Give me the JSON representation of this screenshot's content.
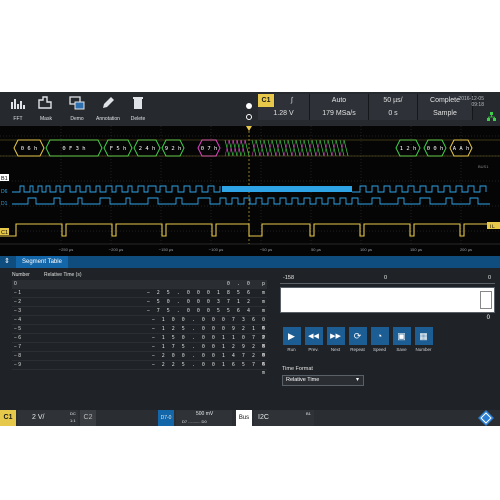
{
  "toolbar": {
    "items": [
      {
        "label": "FFT",
        "icon": "fft-icon"
      },
      {
        "label": "Mask",
        "icon": "mask-icon"
      },
      {
        "label": "Demo",
        "icon": "demo-icon"
      },
      {
        "label": "Annotation",
        "icon": "annotation-icon"
      },
      {
        "label": "Delete",
        "icon": "delete-icon"
      }
    ]
  },
  "trigger": {
    "channel": "C1",
    "level": "1.28 V",
    "mode": "Auto",
    "sample_rate": "179 MSa/s",
    "timebase": "50 µs/",
    "position": "0 s",
    "state": "Complete",
    "acquire": "Sample"
  },
  "datetime": {
    "date": "2016-12-05",
    "time": "09:18"
  },
  "waveform": {
    "bus_label": "B1",
    "bus_hint": "BUS1",
    "ch_d6": "D6",
    "ch_d1": "D1",
    "ch_c1": "C1",
    "tl": "TL",
    "decoded_left": [
      "0 6 h",
      "0 F 3 h",
      "F 5 h",
      "2 4 h",
      "9 2 h",
      "0 7 h"
    ],
    "decoded_right": [
      "1 2 h",
      "0 0 h",
      "A A h"
    ],
    "time_ticks": [
      "−250 µs",
      "−200 µs",
      "−150 µs",
      "−100 µs",
      "−50 µs",
      "50 µs",
      "100 µs",
      "150 µs",
      "200 µs",
      "250 µs"
    ],
    "colors": {
      "bus": "#e6c84a",
      "data": "#2ea4e6",
      "clock": "#e6c84a",
      "green": "#3ecf4a",
      "magenta": "#e040c8"
    }
  },
  "segment_table": {
    "title": "Segment Table",
    "col_number": "Number",
    "col_time": "Relative Time (s)",
    "rows": [
      {
        "n": "0",
        "t": "0 . 0",
        "u": "p"
      },
      {
        "n": "− 1",
        "t": "− 2 5 . 0 0 0   1 8 5   6",
        "u": "m"
      },
      {
        "n": "− 2",
        "t": "− 5 0 . 0 0 0   3 7 1   2",
        "u": "m"
      },
      {
        "n": "− 3",
        "t": "− 7 5 . 0 0 0   5 5 6   4",
        "u": "m"
      },
      {
        "n": "− 4",
        "t": "− 1 0 0 . 0 0 0   7 3 6   0",
        "u": "m"
      },
      {
        "n": "− 5",
        "t": "− 1 2 5 . 0 0 0   9 2 1   6",
        "u": "m"
      },
      {
        "n": "− 6",
        "t": "− 1 5 0 . 0 0 1   1 0 7   2",
        "u": "m"
      },
      {
        "n": "− 7",
        "t": "− 1 7 5 . 0 0 1   2 9 2   8",
        "u": "m"
      },
      {
        "n": "− 8",
        "t": "− 2 0 0 . 0 0 1   4 7 2   0",
        "u": "m"
      },
      {
        "n": "− 9",
        "t": "− 2 2 5 . 0 0 1   6 5 7   6",
        "u": "m"
      }
    ]
  },
  "player": {
    "range_left": "-158",
    "range_mid": "0",
    "range_right": "0",
    "current": "0",
    "controls": [
      {
        "label": "Run",
        "glyph": "▶"
      },
      {
        "label": "Prev.",
        "glyph": "◀◀"
      },
      {
        "label": "Next",
        "glyph": "▶▶"
      },
      {
        "label": "Repeat",
        "glyph": "⟳"
      },
      {
        "label": "Speed",
        "glyph": "◔"
      },
      {
        "label": "Save",
        "glyph": "▣"
      },
      {
        "label": "Number",
        "glyph": "▦"
      }
    ],
    "time_format_label": "Time Format",
    "time_format_value": "Relative Time"
  },
  "status": {
    "c1": "C1",
    "c1_scale": "2 V/",
    "c1_coupling": "DC",
    "c1_sub": "1:1",
    "c2": "C2",
    "d_group": "D7-0",
    "d_level": "500 mV",
    "d_range": "D7 ........... D0",
    "bus": "Bus",
    "bus_protocol": "I2C",
    "bus_id": "B1"
  }
}
